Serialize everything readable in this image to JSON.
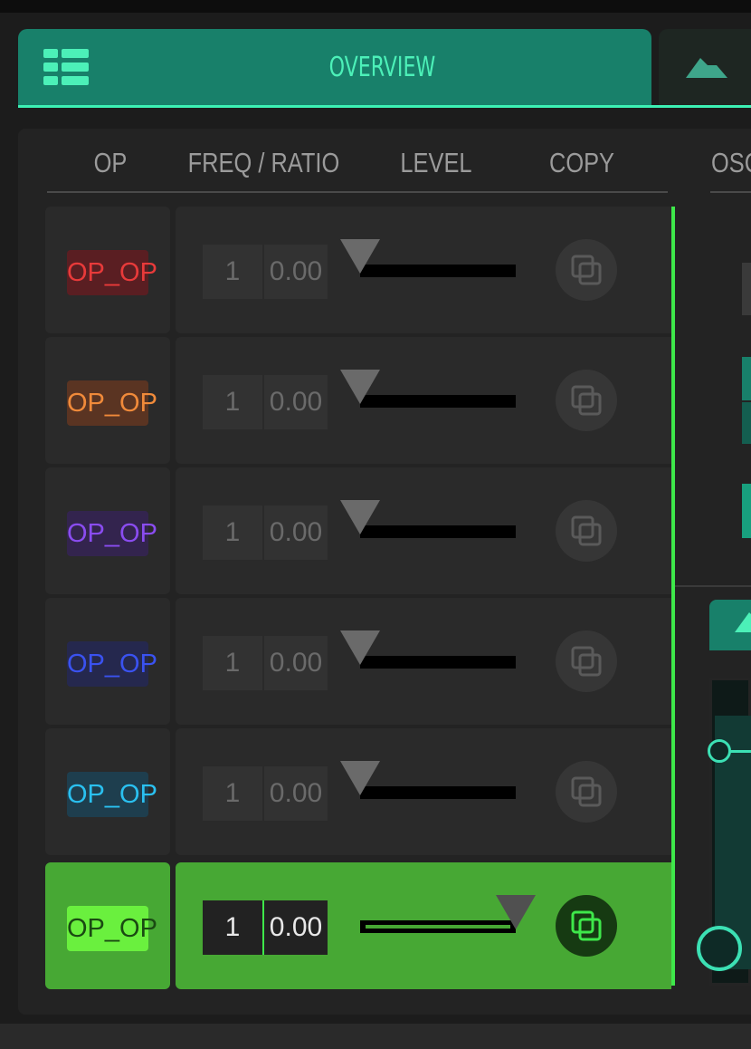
{
  "tabs": {
    "overview_title": "OVERVIEW",
    "overview_icon": "grid-list-icon",
    "second_icon": "envelope-shape-icon"
  },
  "columns": [
    "OP",
    "FREQ / RATIO",
    "LEVEL",
    "COPY"
  ],
  "right_panel": {
    "heading_partial": "OSC"
  },
  "rows": [
    {
      "op_label": "OP_OP",
      "color": "#e83a3a",
      "badge_bg": "#5a1e22",
      "freq_int": "1",
      "freq_dec": "0.00",
      "level": 0.0,
      "active": false
    },
    {
      "op_label": "OP_OP",
      "color": "#f08a3a",
      "badge_bg": "#5a3422",
      "freq_int": "1",
      "freq_dec": "0.00",
      "level": 0.0,
      "active": false
    },
    {
      "op_label": "OP_OP",
      "color": "#8a4cf0",
      "badge_bg": "#33244e",
      "freq_int": "1",
      "freq_dec": "0.00",
      "level": 0.0,
      "active": false
    },
    {
      "op_label": "OP_OP",
      "color": "#3a52f0",
      "badge_bg": "#25284e",
      "freq_int": "1",
      "freq_dec": "0.00",
      "level": 0.0,
      "active": false
    },
    {
      "op_label": "OP_OP",
      "color": "#2ac0f0",
      "badge_bg": "#1e3e4e",
      "freq_int": "1",
      "freq_dec": "0.00",
      "level": 0.0,
      "active": false
    },
    {
      "op_label": "OP_OP",
      "color": "#1a4a12",
      "badge_bg": "#6af03e",
      "freq_int": "1",
      "freq_dec": "0.00",
      "level": 1.0,
      "active": true
    }
  ],
  "colors": {
    "accent_teal": "#18806a",
    "accent_mint": "#4cf0b8",
    "accent_green": "#3ee84a"
  }
}
